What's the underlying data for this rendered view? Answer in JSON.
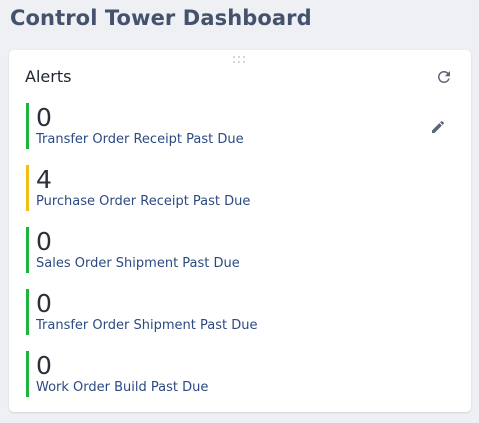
{
  "page": {
    "title": "Control Tower Dashboard"
  },
  "widget": {
    "title": "Alerts",
    "icons": {
      "drag": "drag-handle-icon",
      "refresh": "refresh-icon",
      "edit": "pencil-icon"
    },
    "alerts": [
      {
        "count": "0",
        "label": "Transfer Order Receipt Past Due",
        "status": "ok",
        "color": "#1db53e"
      },
      {
        "count": "4",
        "label": "Purchase Order Receipt Past Due",
        "status": "warning",
        "color": "#f2bd14"
      },
      {
        "count": "0",
        "label": "Sales Order Shipment Past Due",
        "status": "ok",
        "color": "#1db53e"
      },
      {
        "count": "0",
        "label": "Transfer Order Shipment Past Due",
        "status": "ok",
        "color": "#1db53e"
      },
      {
        "count": "0",
        "label": "Work Order Build Past Due",
        "status": "ok",
        "color": "#1db53e"
      }
    ]
  },
  "colors": {
    "title": "#44526e",
    "link": "#2c4a82",
    "icon": "#5b6478",
    "background": "#eef0f4"
  }
}
